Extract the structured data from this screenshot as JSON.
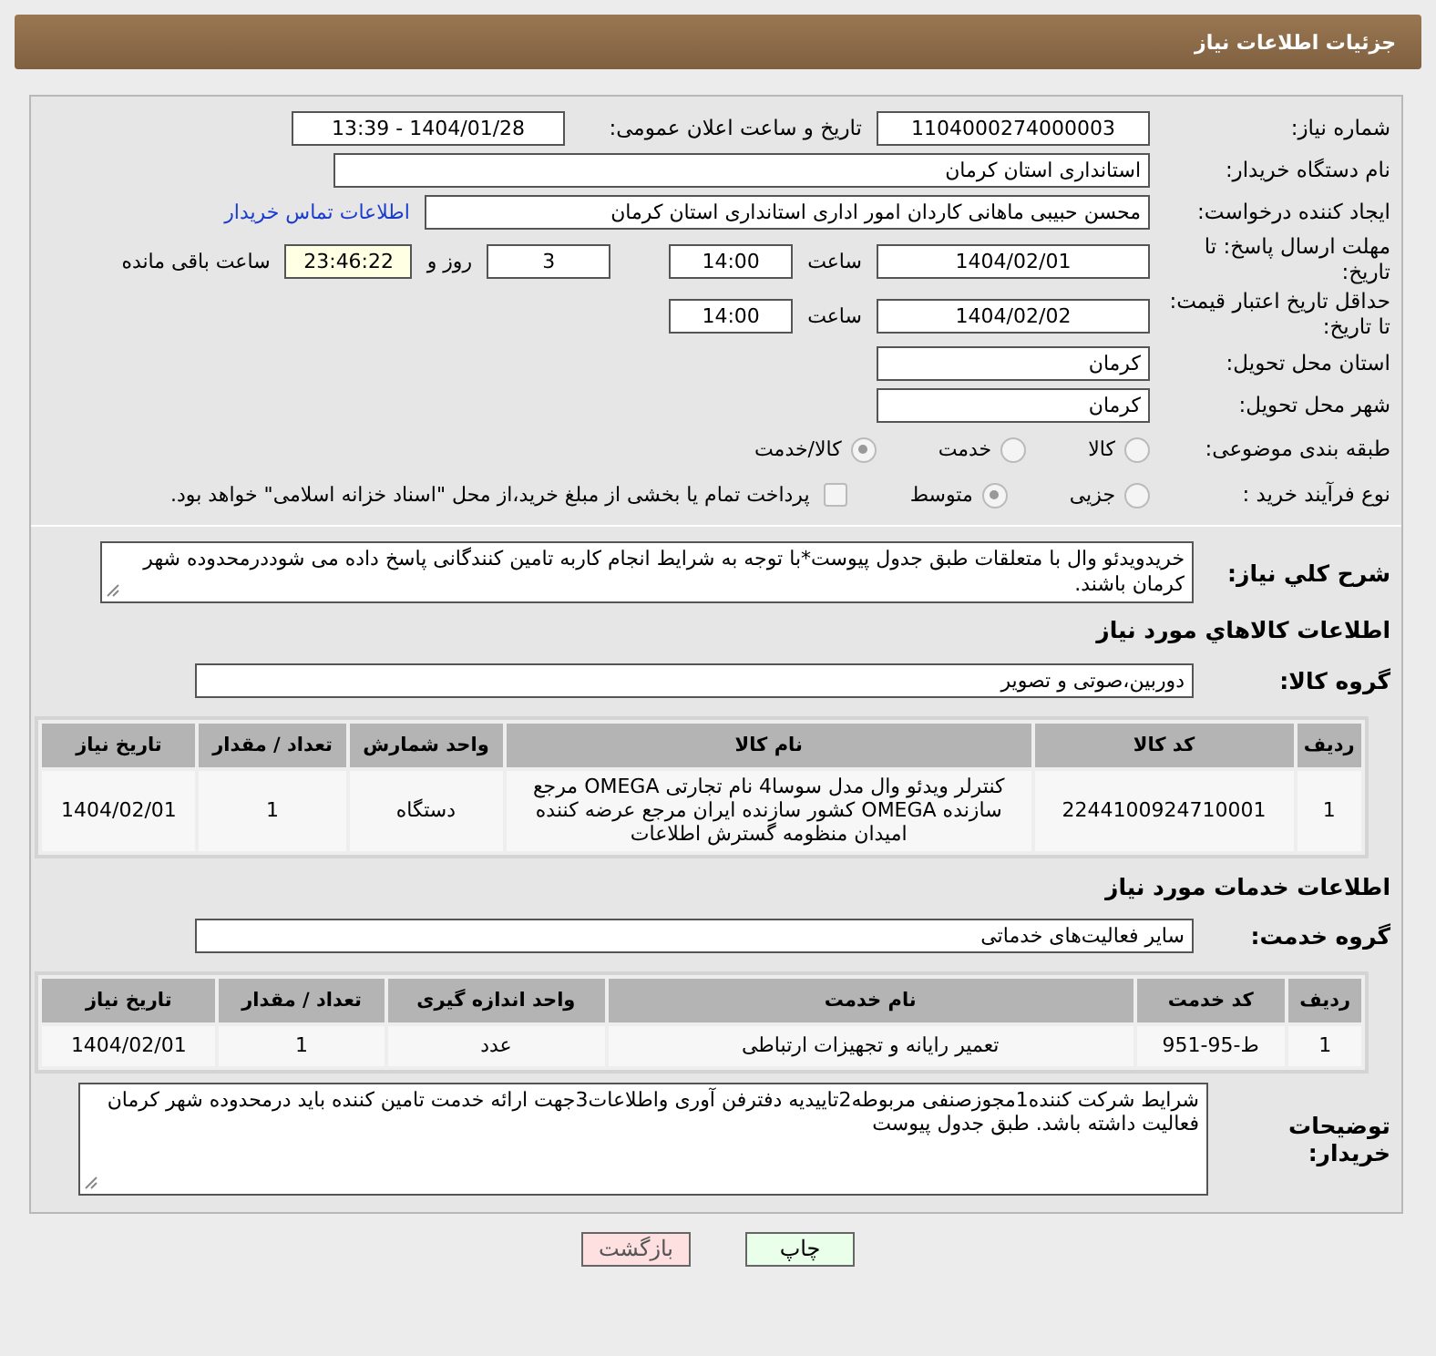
{
  "header": {
    "title": "جزئیات اطلاعات نیاز"
  },
  "need_number": {
    "label": "شماره نیاز:",
    "value": "1104000274000003"
  },
  "announce": {
    "label": "تاریخ و ساعت اعلان عمومی:",
    "value": "1404/01/28 - 13:39"
  },
  "buyer_org": {
    "label": "نام دستگاه خریدار:",
    "value": "استانداری استان کرمان"
  },
  "creator": {
    "label": "ایجاد کننده درخواست:",
    "value": "محسن حبیبی ماهانی کاردان امور اداری استانداری استان کرمان",
    "link": "اطلاعات تماس خریدار"
  },
  "reply_deadline": {
    "label": "مهلت ارسال پاسخ: تا تاریخ:",
    "date": "1404/02/01",
    "time_label": "ساعت",
    "time": "14:00",
    "days": "3",
    "days_label": "روز و",
    "remaining": "23:46:22",
    "remaining_label": "ساعت باقی مانده"
  },
  "price_validity": {
    "label": "حداقل تاریخ اعتبار قیمت: تا تاریخ:",
    "date": "1404/02/02",
    "time_label": "ساعت",
    "time": "14:00"
  },
  "province": {
    "label": "استان محل تحویل:",
    "value": "کرمان"
  },
  "city": {
    "label": "شهر محل تحویل:",
    "value": "کرمان"
  },
  "category": {
    "label": "طبقه بندی موضوعی:",
    "options": [
      {
        "label": "کالا",
        "selected": false
      },
      {
        "label": "خدمت",
        "selected": false
      },
      {
        "label": "کالا/خدمت",
        "selected": true
      }
    ]
  },
  "process": {
    "label": "نوع فرآیند خرید :",
    "options": [
      {
        "label": "جزیی",
        "selected": false
      },
      {
        "label": "متوسط",
        "selected": true
      }
    ],
    "payment": {
      "label": "پرداخت تمام یا بخشی از مبلغ خرید،از محل \"اسناد خزانه اسلامی\" خواهد بود.",
      "checked": false
    }
  },
  "description": {
    "label": "شرح کلي نياز:",
    "value": "خریدویدئو وال با متعلقات طبق جدول پیوست*با توجه به شرایط انجام کاربه تامین کنندگانی پاسخ داده می شوددرمحدوده شهر کرمان باشند."
  },
  "goods": {
    "title": "اطلاعات کالاهاي مورد نياز",
    "group_label": "گروه کالا:",
    "group": "دوربین،صوتی و تصویر",
    "columns": [
      "ردیف",
      "کد کالا",
      "نام کالا",
      "واحد شمارش",
      "تعداد / مقدار",
      "تاریخ نیاز"
    ],
    "rows": [
      [
        "1",
        "2244100924710001",
        "کنترلر ویدئو وال مدل سوسا4 نام تجارتی OMEGA مرجع سازنده OMEGA کشور سازنده ایران مرجع عرضه کننده امیدان منظومه گسترش اطلاعات",
        "دستگاه",
        "1",
        "1404/02/01"
      ]
    ]
  },
  "services": {
    "title": "اطلاعات خدمات مورد نياز",
    "group_label": "گروه خدمت:",
    "group": "سایر فعالیت‌های خدماتی",
    "columns": [
      "ردیف",
      "کد خدمت",
      "نام خدمت",
      "واحد اندازه گیری",
      "تعداد / مقدار",
      "تاریخ نیاز"
    ],
    "rows": [
      [
        "1",
        "ط-95-951",
        "تعمیر رایانه و تجهیزات ارتباطی",
        "عدد",
        "1",
        "1404/02/01"
      ]
    ]
  },
  "notes": {
    "label": "توضیحات خریدار:",
    "value": "شرایط شرکت کننده1مجوزصنفی مربوطه2تاییدیه دفترفن آوری واطلاعات3جهت ارائه خدمت تامین کننده باید درمحدوده شهر کرمان فعالیت داشته باشد. طبق جدول پیوست"
  },
  "buttons": [
    {
      "kind": "print",
      "label": "چاپ"
    },
    {
      "kind": "back",
      "label": "بازگشت"
    }
  ]
}
